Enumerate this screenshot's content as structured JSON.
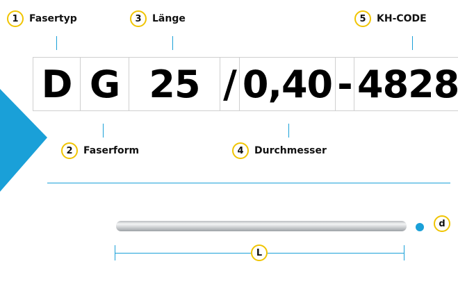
{
  "callouts": [
    {
      "num": "1",
      "label": "Fasertyp"
    },
    {
      "num": "2",
      "label": "Faserform"
    },
    {
      "num": "3",
      "label": "Länge"
    },
    {
      "num": "4",
      "label": "Durchmesser"
    },
    {
      "num": "5",
      "label": "KH-CODE"
    }
  ],
  "code": {
    "type": "D",
    "form": "G",
    "length": "25",
    "slash": "/",
    "diameter": "0,40",
    "dash": "-",
    "kh_code": "4828"
  },
  "dimensions": {
    "diameter_label": "d",
    "length_label": "L"
  },
  "colors": {
    "accent_blue": "#1aa0d8",
    "callout_ring": "#f0c400",
    "rod_silver": "#d6d8da"
  }
}
